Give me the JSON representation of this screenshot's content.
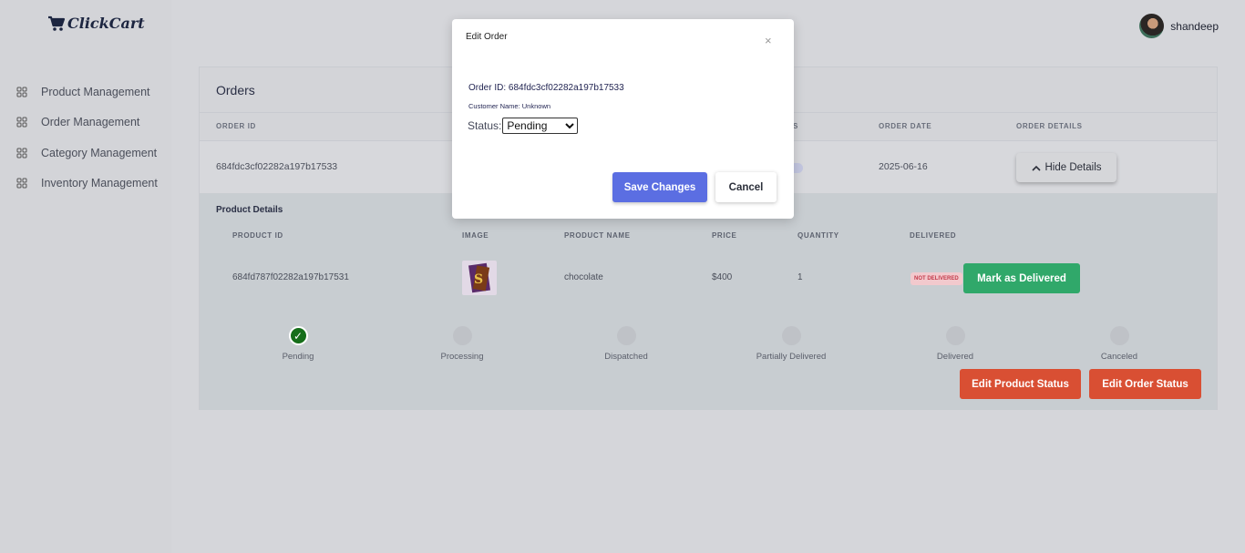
{
  "brand": {
    "name": "ClickCart",
    "icon": "cart-icon"
  },
  "sidebar": {
    "items": [
      {
        "label": "Product Management",
        "icon": "grid-icon"
      },
      {
        "label": "Order Management",
        "icon": "grid-icon"
      },
      {
        "label": "Category Management",
        "icon": "grid-icon"
      },
      {
        "label": "Inventory Management",
        "icon": "grid-icon"
      }
    ]
  },
  "user": {
    "name": "shandeep"
  },
  "orders": {
    "title": "Orders",
    "columns": {
      "order_id": "ORDER ID",
      "status_partial": "S",
      "order_date": "ORDER DATE",
      "order_details": "ORDER DETAILS"
    },
    "row": {
      "order_id": "684fdc3cf02282a197b17533",
      "order_date": "2025-06-16",
      "hide_details_label": "Hide Details"
    }
  },
  "product_details": {
    "title": "Product Details",
    "columns": {
      "product_id": "PRODUCT ID",
      "image": "IMAGE",
      "product_name": "PRODUCT NAME",
      "price": "PRICE",
      "quantity": "QUANTITY",
      "delivered": "DELIVERED"
    },
    "row": {
      "product_id": "684fd787f02282a197b17531",
      "product_name": "chocolate",
      "price": "$400",
      "quantity": "1",
      "delivered_badge": "NOT DELIVERED",
      "mark_delivered_label": "Mark as Delivered"
    }
  },
  "progress": {
    "steps": [
      {
        "label": "Pending",
        "done": true
      },
      {
        "label": "Processing",
        "done": false
      },
      {
        "label": "Dispatched",
        "done": false
      },
      {
        "label": "Partially Delivered",
        "done": false
      },
      {
        "label": "Delivered",
        "done": false
      },
      {
        "label": "Canceled",
        "done": false
      }
    ],
    "check_glyph": "✓"
  },
  "actions": {
    "edit_product_status": "Edit Product Status",
    "edit_order_status": "Edit Order Status"
  },
  "modal": {
    "title": "Edit Order",
    "close_glyph": "×",
    "order_id_text": "Order ID: 684fdc3cf02282a197b17533",
    "customer_text": "Customer Name: Unknown",
    "status_label": "Status:",
    "status_value": "Pending",
    "save_label": "Save Changes",
    "cancel_label": "Cancel"
  },
  "colors": {
    "accent": "#5b6ee2",
    "success": "#30a86a",
    "danger": "#d94f33",
    "step_done": "#166e1a"
  }
}
